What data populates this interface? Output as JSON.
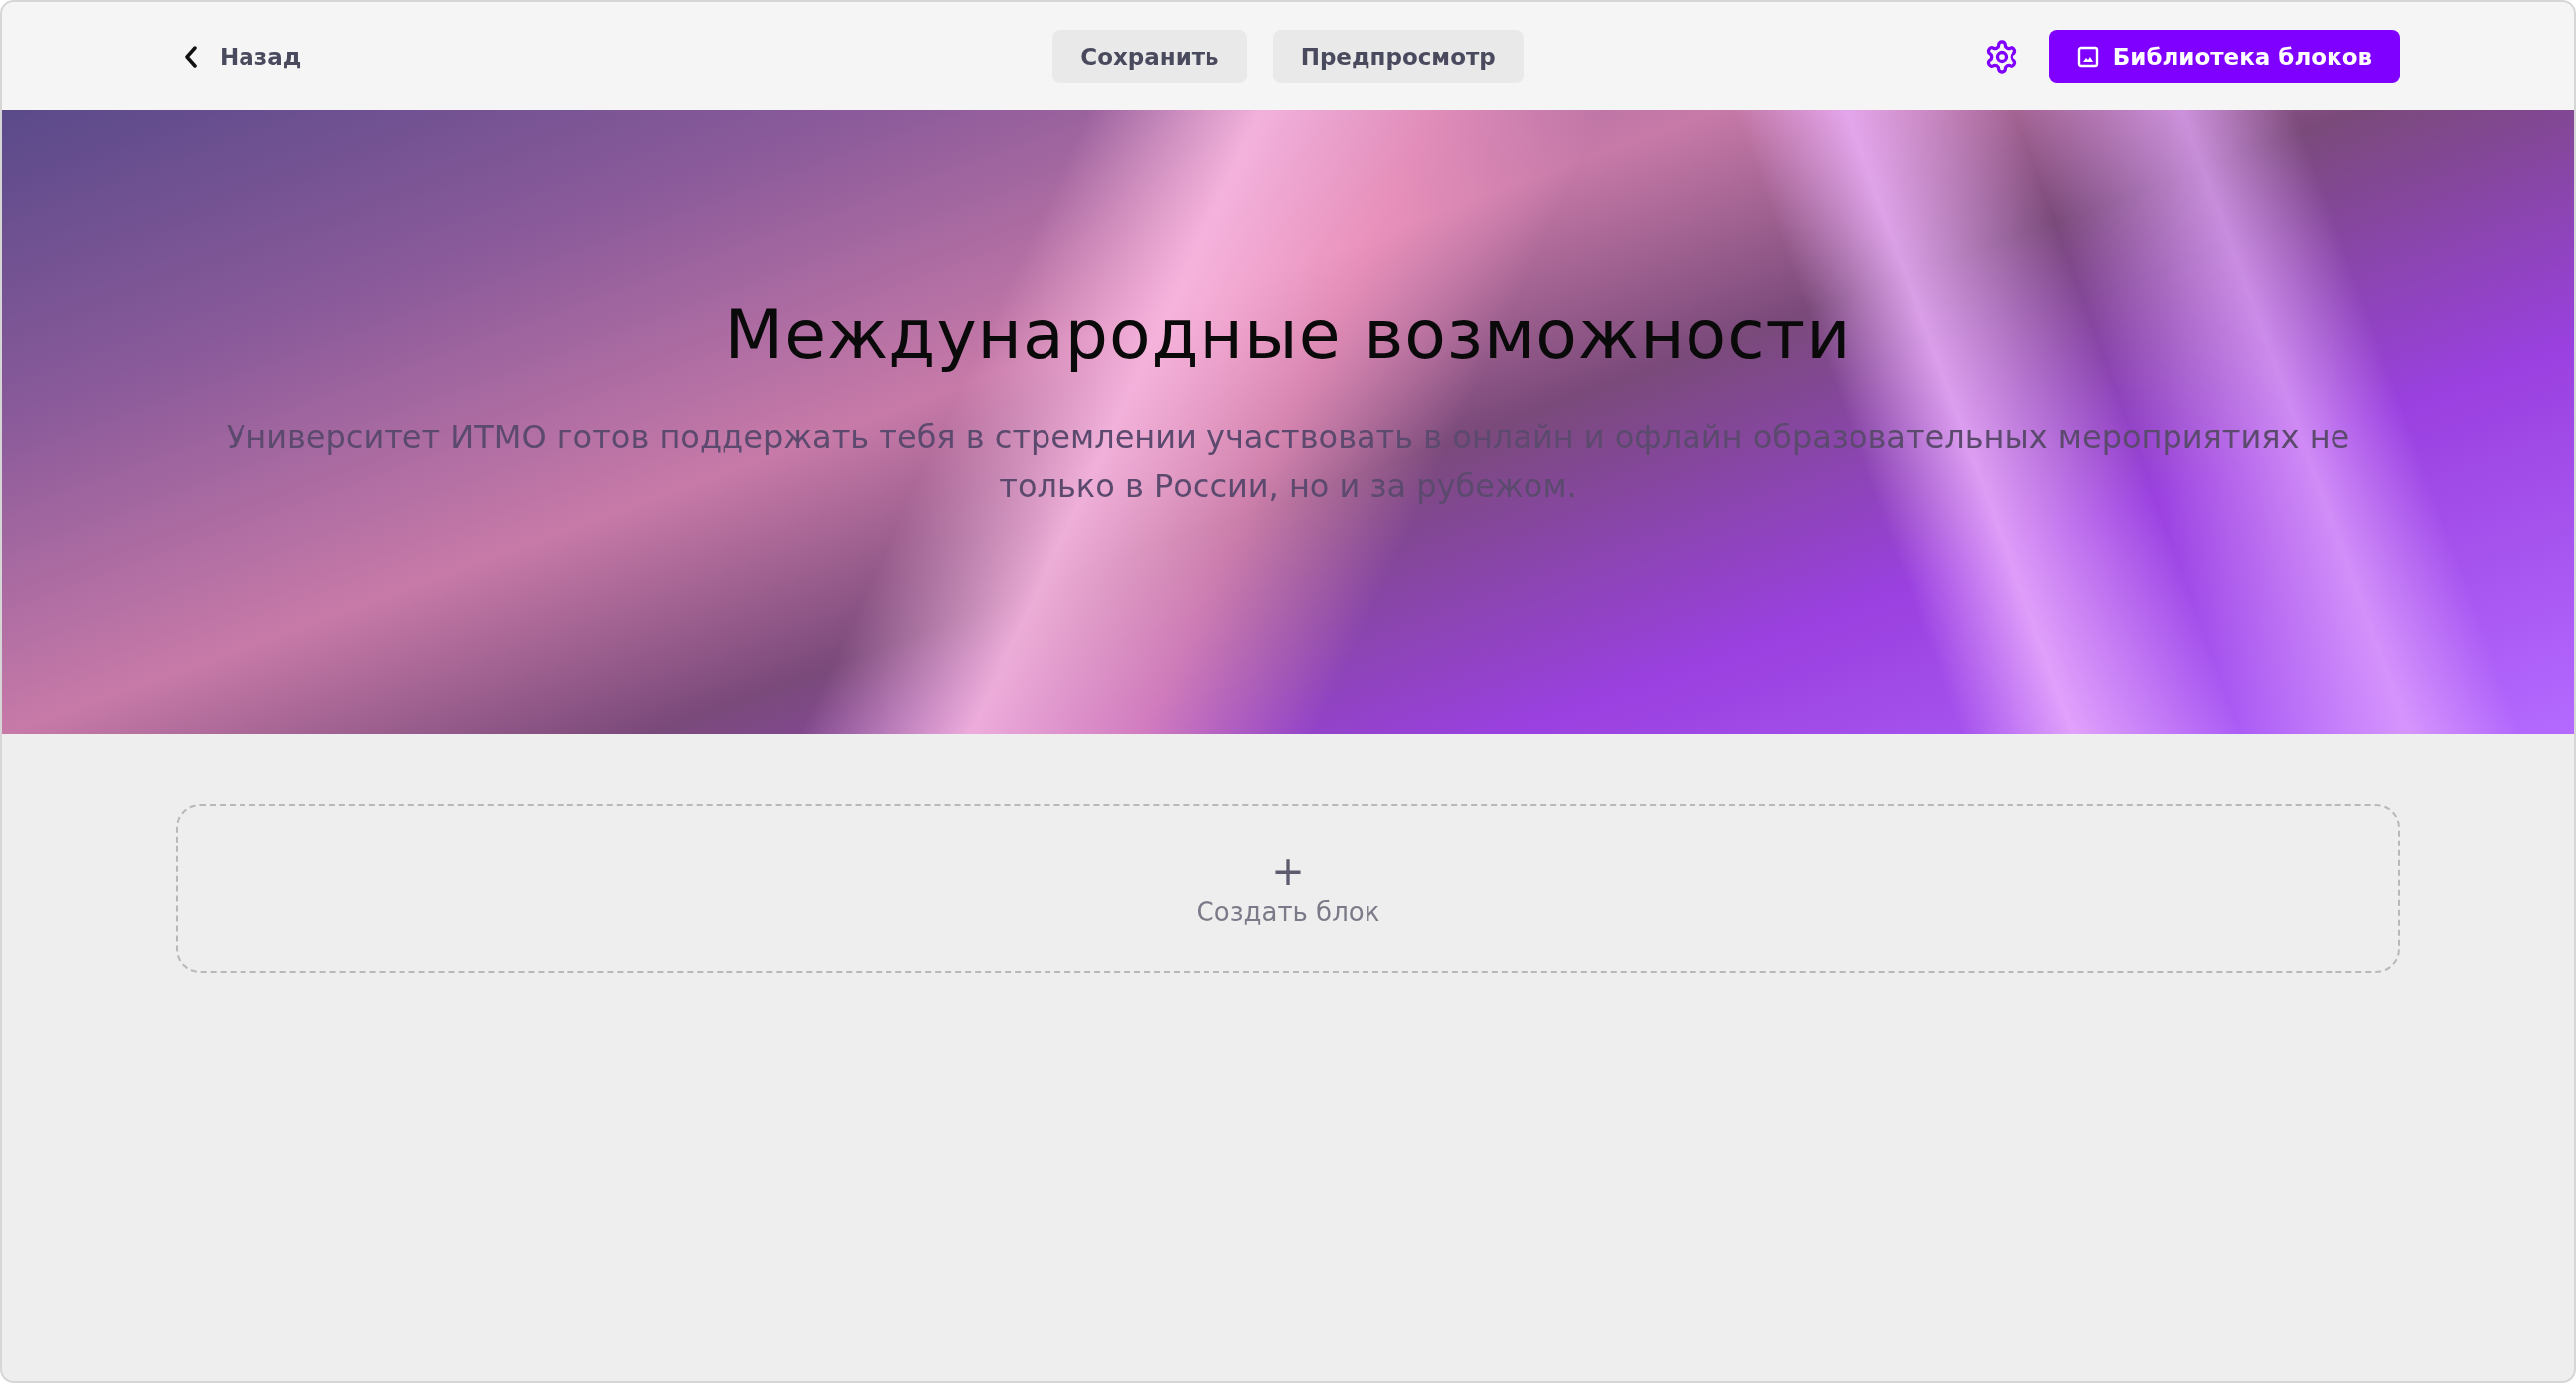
{
  "header": {
    "back": {
      "label": "Назад"
    },
    "actions": [
      {
        "label": "Сохранить"
      },
      {
        "label": "Предпросмотр"
      }
    ],
    "library_button": {
      "label": "Библиотека блоков"
    }
  },
  "hero": {
    "title": "Международные возможности",
    "subtitle": "Университет ИТМО готов поддержать тебя в стремлении участвовать в онлайн и офлайн образовательных мероприятиях не только в России, но и за рубежом."
  },
  "create_block": {
    "label": "Создать блок",
    "icon": "+"
  }
}
